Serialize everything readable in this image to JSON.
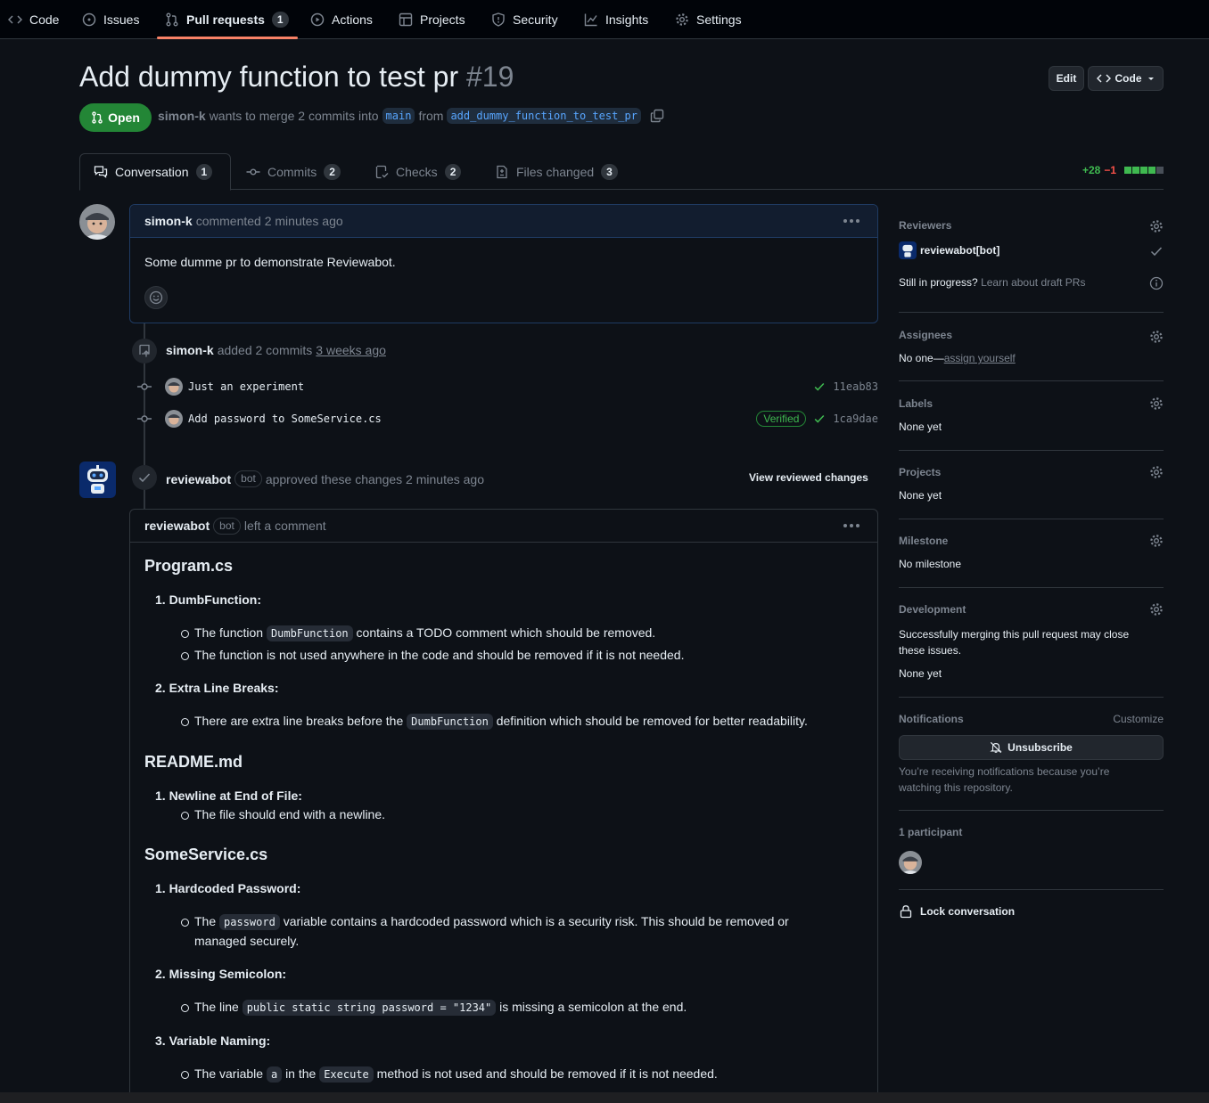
{
  "colors": {
    "accent": "#f78166",
    "open": "#238636",
    "link": "#58a6ff",
    "add": "#3fb950",
    "del": "#f85149"
  },
  "nav": {
    "items": [
      {
        "label": "Code",
        "icon": "code-icon"
      },
      {
        "label": "Issues",
        "icon": "issue-icon"
      },
      {
        "label": "Pull requests",
        "icon": "pull-request-icon",
        "count": "1"
      },
      {
        "label": "Actions",
        "icon": "play-icon"
      },
      {
        "label": "Projects",
        "icon": "table-icon"
      },
      {
        "label": "Security",
        "icon": "shield-icon"
      },
      {
        "label": "Insights",
        "icon": "graph-icon"
      },
      {
        "label": "Settings",
        "icon": "gear-icon"
      }
    ]
  },
  "pr": {
    "title": "Add dummy function to test pr",
    "number": "#19",
    "edit_label": "Edit",
    "code_label": "Code",
    "state": "Open",
    "author": "simon-k",
    "merge_text": "wants to merge 2 commits into",
    "base_branch": "main",
    "from_text": "from",
    "head_branch": "add_dummy_function_to_test_pr"
  },
  "tabs": [
    {
      "label": "Conversation",
      "count": "1"
    },
    {
      "label": "Commits",
      "count": "2"
    },
    {
      "label": "Checks",
      "count": "2"
    },
    {
      "label": "Files changed",
      "count": "3"
    }
  ],
  "diffstat": {
    "additions": "+28",
    "deletions": "−1"
  },
  "comment": {
    "author": "simon-k",
    "action": "commented 2 minutes ago",
    "body": "Some dumme pr to demonstrate Reviewabot."
  },
  "commits_event": {
    "author": "simon-k",
    "action": "added 2 commits",
    "time": "3 weeks ago",
    "commits": [
      {
        "message": "Just an experiment",
        "sha": "11eab83",
        "verified": ""
      },
      {
        "message": "Add password to SomeService.cs",
        "sha": "1ca9dae",
        "verified": "Verified"
      }
    ]
  },
  "review_event": {
    "author": "reviewabot",
    "bot_label": "bot",
    "action": "approved these changes 2 minutes ago",
    "view_link": "View reviewed changes"
  },
  "review_comment": {
    "author": "reviewabot",
    "bot_label": "bot",
    "action": "left a comment",
    "sections": {
      "program": {
        "title": "Program.cs",
        "i1": "1. DumbFunction:",
        "i1b1_pre": "The function",
        "i1b1_code": "DumbFunction",
        "i1b1_post": "contains a TODO comment which should be removed.",
        "i1b2": "The function is not used anywhere in the code and should be removed if it is not needed.",
        "i2": "2. Extra Line Breaks:",
        "i2b1_pre": "There are extra line breaks before the",
        "i2b1_code": "DumbFunction",
        "i2b1_post": "definition which should be removed for better readability."
      },
      "readme": {
        "title": "README.md",
        "i1": "1. Newline at End of File:",
        "i1b1": "The file should end with a newline."
      },
      "someservice": {
        "title": "SomeService.cs",
        "i1": "1. Hardcoded Password:",
        "i1b1_pre": "The",
        "i1b1_code": "password",
        "i1b1_post": "variable contains a hardcoded password which is a security risk. This should be removed or",
        "i1b1_line2": "managed securely.",
        "i2": "2. Missing Semicolon:",
        "i2b1_pre": "The line",
        "i2b1_code": "public static string password = \"1234\"",
        "i2b1_post": "is missing a semicolon at the end.",
        "i3": "3. Variable Naming:",
        "i3b1_pre": "The variable",
        "i3b1_code": "a",
        "i3b1_mid": "in the",
        "i3b1_code2": "Execute",
        "i3b1_post": "method is not used and should be removed if it is not needed."
      }
    }
  },
  "sidebar": {
    "reviewers": {
      "title": "Reviewers",
      "name": "reviewabot[bot]",
      "draft_q": "Still in progress?",
      "draft_link": "Learn about draft PRs"
    },
    "assignees": {
      "title": "Assignees",
      "value": "No one—",
      "link": "assign yourself"
    },
    "labels": {
      "title": "Labels",
      "value": "None yet"
    },
    "projects": {
      "title": "Projects",
      "value": "None yet"
    },
    "milestone": {
      "title": "Milestone",
      "value": "No milestone"
    },
    "development": {
      "title": "Development",
      "line1": "Successfully merging this pull request may close",
      "line2": "these issues.",
      "value": "None yet"
    },
    "notifications": {
      "title": "Notifications",
      "customize": "Customize",
      "button": "Unsubscribe",
      "line1": "You’re receiving notifications because you’re",
      "line2": "watching this repository."
    },
    "participants": {
      "title": "1 participant"
    },
    "lock": "Lock conversation"
  }
}
